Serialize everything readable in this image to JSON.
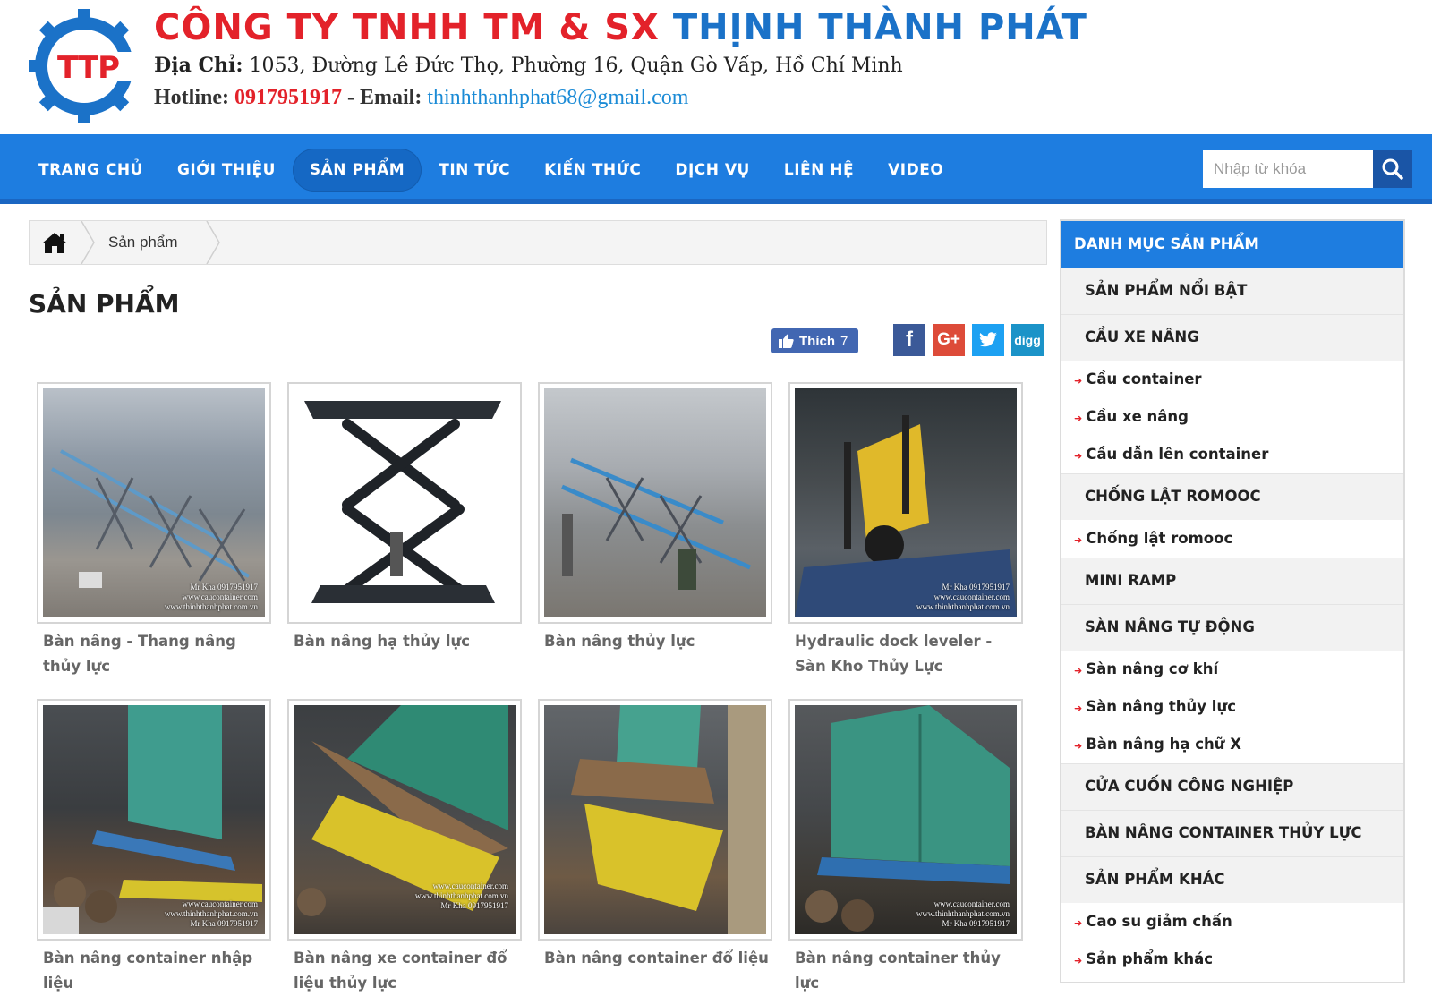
{
  "header": {
    "logo_text": "TTP",
    "company_part1": "CÔNG TY TNHH TM & SX",
    "company_part2": "THỊNH THÀNH PHÁT",
    "address_label": "Địa Chỉ:",
    "address_value": "1053, Đường Lê Đức Thọ, Phường 16, Quận Gò Vấp, Hồ Chí Minh",
    "hotline_label": "Hotline:",
    "hotline_value": "0917951917",
    "email_sep": " - Email:",
    "email_value": "thinhthanhphat68@gmail.com"
  },
  "nav": {
    "items": [
      "TRANG CHỦ",
      "GIỚI THIỆU",
      "SẢN PHẨM",
      "TIN TỨC",
      "KIẾN THỨC",
      "DỊCH VỤ",
      "LIÊN HỆ",
      "VIDEO"
    ],
    "active": "SẢN PHẨM",
    "search_placeholder": "Nhập từ khóa"
  },
  "breadcrumb": {
    "current": "Sản phẩm"
  },
  "page_title": "SẢN PHẨM",
  "social": {
    "like_label": "Thích",
    "like_count": "7",
    "digg_label": "digg"
  },
  "products": [
    {
      "name": "Bàn nâng - Thang nâng thủy lực"
    },
    {
      "name": "Bàn nâng hạ thủy lực"
    },
    {
      "name": "Bàn nâng thủy lực"
    },
    {
      "name": "Hydraulic dock leveler - Sàn Kho Thủy Lực"
    },
    {
      "name": "Bàn nâng container nhập liệu"
    },
    {
      "name": "Bàn nâng xe container đổ liệu thủy lực"
    },
    {
      "name": "Bàn nâng container đổ liệu"
    },
    {
      "name": "Bàn nâng container thủy lực"
    }
  ],
  "watermarks": {
    "w1": [
      "Mr Kha 0917951917",
      "www.caucontainer.com",
      "www.thinhthanhphat.com.vn"
    ],
    "w2": [
      "www.caucontainer.com",
      "www.thinhthanhphat.com.vn",
      "Mr Kha 0917951917"
    ]
  },
  "sidebar": {
    "title": "DANH MỤC SẢN PHẨM",
    "cat_noi_bat": "SẢN PHẨM NỔI BẬT",
    "cat_cau_xe_nang": "CẦU XE NÂNG",
    "sub_cau_container": "Cầu container",
    "sub_cau_xe_nang": "Cầu xe nâng",
    "sub_cau_dan": "Cầu dẫn lên container",
    "cat_chong_lat": "CHỐNG LẬT ROMOOC",
    "sub_chong_lat": "Chống lật romooc",
    "cat_mini_ramp": "MINI RAMP",
    "cat_san_nang": "SÀN NÂNG TỰ ĐỘNG",
    "sub_san_co_khi": "Sàn nâng cơ khí",
    "sub_san_thuy_luc": "Sàn nâng thủy lực",
    "sub_ban_nang_x": "Bàn nâng hạ chữ X",
    "cat_cua_cuon": "CỬA CUỐN CÔNG NGHIỆP",
    "cat_ban_nang_container": "BÀN NÂNG CONTAINER THỦY LỰC",
    "cat_khac": "SẢN PHẨM KHÁC",
    "sub_cao_su": "Cao su giảm chấn",
    "sub_khac": "Sản phẩm khác"
  }
}
